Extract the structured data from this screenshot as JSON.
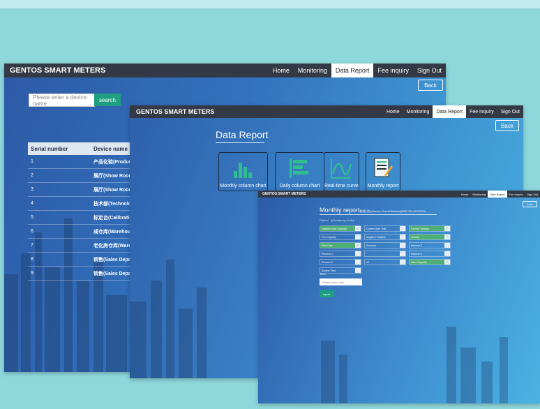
{
  "windows": {
    "w1": {
      "brand": "GENTOS SMART METERS",
      "nav": [
        "Home",
        "Monitoring",
        "Data Report",
        "Fee inquiry",
        "Sign Out"
      ],
      "back": "Back",
      "search_placeholder": "Please enter a device name",
      "search_button": "search",
      "table_headers": [
        "Serial number",
        "Device name"
      ],
      "rows": [
        {
          "serial": "1",
          "name": "产品化验(Produc"
        },
        {
          "serial": "2",
          "name": "展厅(Show Room"
        },
        {
          "serial": "3",
          "name": "展厅(Show Room"
        },
        {
          "serial": "4",
          "name": "技术部(Technolo"
        },
        {
          "serial": "5",
          "name": "标定台(Calibratio"
        },
        {
          "serial": "6",
          "name": "成仓库(Warehous"
        },
        {
          "serial": "7",
          "name": "老化房仓库(Ware"
        },
        {
          "serial": "8",
          "name": "销售(Sales Depa"
        },
        {
          "serial": "9",
          "name": "销售(Sales Depa"
        }
      ]
    },
    "w2": {
      "brand": "GENTOS SMART METERS",
      "nav": [
        "Home",
        "Monitoring",
        "Data Report",
        "Fee inquiry",
        "Sign Out"
      ],
      "back": "Back",
      "title": "Data Report",
      "tiles": [
        {
          "label": "Monthly column chart",
          "icon": "bar-chart-icon"
        },
        {
          "label": "Daily column chart",
          "icon": "horizontal-bar-chart-icon"
        },
        {
          "label": "Real-time curve",
          "icon": "line-curve-icon"
        },
        {
          "label": "Monthly report",
          "icon": "report-document-icon"
        }
      ]
    },
    "w3": {
      "brand": "GENTOS SMART METERS",
      "nav": [
        "Home",
        "Monitoring",
        "Data Report",
        "Fee inquiry",
        "Sign Out"
      ],
      "back": "Back",
      "title": "Monthly report",
      "title_sub": "能耗分析(Gentos Overall Meters)(DNE SN:v0010011)",
      "option_label": "Option：  (Choose up to six)",
      "options": [
        [
          {
            "label": "Totalizer User Capacity",
            "checked": true
          },
          {
            "label": "Part Capacity",
            "checked": false
          },
          {
            "label": "Flow Rate",
            "checked": true
          },
          {
            "label": "Reverse 1",
            "checked": false
          },
          {
            "label": "Reverse 2",
            "checked": false
          },
          {
            "label": "System Time",
            "checked": false
          }
        ],
        [
          {
            "label": "Current User Time",
            "checked": false
          },
          {
            "label": "Negative Totalizer",
            "checked": false
          },
          {
            "label": "Pressure",
            "checked": false
          },
          {
            "label": "",
            "checked": false
          },
          {
            "label": "c3",
            "checked": false
          }
        ],
        [
          {
            "label": "Positive Totalizer",
            "checked": true
          },
          {
            "label": "Velocity",
            "checked": true
          },
          {
            "label": "Reserve 3",
            "checked": false
          },
          {
            "label": "Reserve 4",
            "checked": false
          },
          {
            "label": "Used Capacity",
            "checked": true
          }
        ]
      ],
      "time_label": "Time",
      "time_placeholder": "Please select time",
      "report_button": "report"
    }
  },
  "colors": {
    "navbar": "#343a45",
    "accent_green": "#1e9f80",
    "checked_green": "#4fae74"
  }
}
